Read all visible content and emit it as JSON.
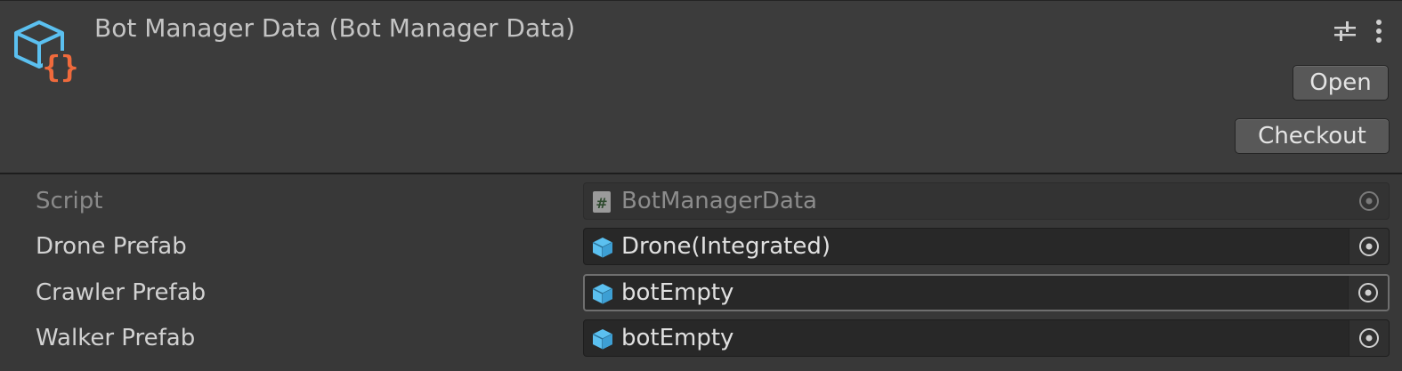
{
  "header": {
    "title": "Bot Manager Data (Bot Manager Data)",
    "open_label": "Open",
    "checkout_label": "Checkout",
    "asset_icon": "scriptable-object-icon",
    "settings_icon": "sliders-icon",
    "more_icon": "kebab-menu-icon"
  },
  "fields": [
    {
      "label": "Script",
      "value": "BotManagerData",
      "icon": "csharp-script-icon",
      "disabled": true
    },
    {
      "label": "Drone Prefab",
      "value": "Drone(Integrated)",
      "icon": "prefab-cube-icon"
    },
    {
      "label": "Crawler Prefab",
      "value": "botEmpty",
      "icon": "prefab-cube-icon",
      "focused": true
    },
    {
      "label": "Walker Prefab",
      "value": "botEmpty",
      "icon": "prefab-cube-icon"
    }
  ],
  "colors": {
    "background": "#383838",
    "header": "#3c3c3c",
    "field": "#282828",
    "cube_icon": "#5bc0f0",
    "braces_icon": "#f06a3c"
  }
}
